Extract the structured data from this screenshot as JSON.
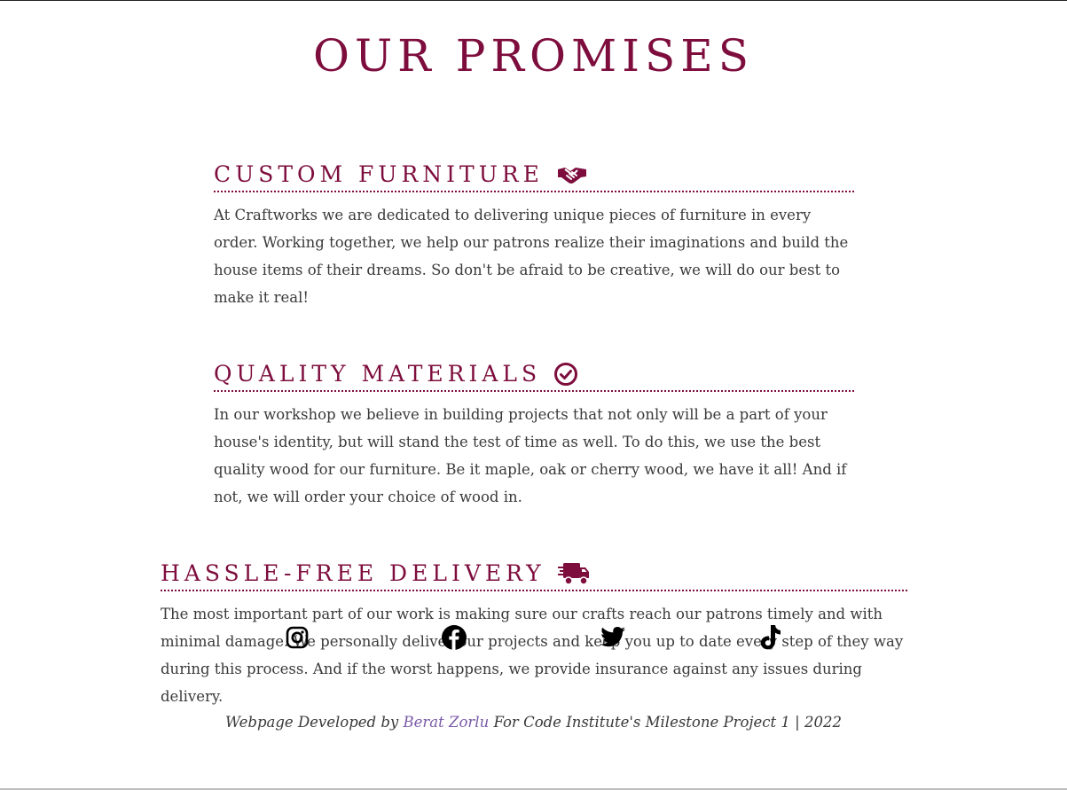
{
  "page": {
    "title": "OUR PROMISES"
  },
  "sections": [
    {
      "heading": "CUSTOM FURNITURE",
      "icon": "handshake-icon",
      "text": "At Craftworks we are dedicated to delivering unique pieces of furniture in every order. Working together, we help our patrons realize their imaginations and build the house items of their dreams. So don't be afraid to be creative, we will do our best to make it real!"
    },
    {
      "heading": "QUALITY MATERIALS",
      "icon": "check-circle-icon",
      "text": "In our workshop we believe in building projects that not only will be a part of your house's identity, but will stand the test of time as well. To do this, we use the best quality wood for our furniture. Be it maple, oak or cherry wood, we have it all! And if not, we will order your choice of wood in."
    },
    {
      "heading": "HASSLE-FREE DELIVERY",
      "icon": "delivery-truck-icon",
      "text": "The most important part of our work is making sure our crafts reach our patrons timely and with minimal damage. We personally deliver our projects and keep you up to date every step of they way during this process. And if the worst happens, we provide insurance against any issues during delivery."
    }
  ],
  "social": [
    {
      "name": "instagram-icon"
    },
    {
      "name": "facebook-icon"
    },
    {
      "name": "twitter-icon"
    },
    {
      "name": "tiktok-icon"
    }
  ],
  "footer": {
    "prefix": "Webpage Developed by",
    "author": "Berat Zorlu",
    "suffix": "For Code Institute's Milestone Project 1 | 2022"
  },
  "colors": {
    "accent": "#7d0d3d",
    "text": "#3a3a3a",
    "link": "#7a5aa8"
  }
}
